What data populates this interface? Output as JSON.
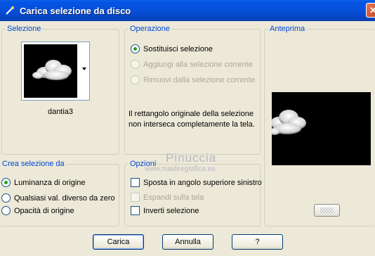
{
  "window": {
    "title": "Carica selezione da disco",
    "close_symbol": "✕"
  },
  "selezione": {
    "label": "Selezione",
    "selected_name": "dantia3"
  },
  "operazione": {
    "label": "Operazione",
    "options": [
      {
        "label": "Sostituisci selezione",
        "checked": true,
        "enabled": true
      },
      {
        "label": "Aggiungi alla selezione corrente",
        "checked": false,
        "enabled": false
      },
      {
        "label": "Rimuovi dalla selezione corrente",
        "checked": false,
        "enabled": false
      }
    ],
    "message_line1": "Il rettangolo originale della selezione",
    "message_line2": "non interseca completamente la tela."
  },
  "anteprima": {
    "label": "Anteprima"
  },
  "crea": {
    "label": "Crea selezione da",
    "options": [
      {
        "label": "Luminanza di origine",
        "checked": true
      },
      {
        "label": "Qualsiasi val. diverso da zero",
        "checked": false
      },
      {
        "label": "Opacità di origine",
        "checked": false
      }
    ]
  },
  "opzioni": {
    "label": "Opzioni",
    "items": [
      {
        "label": "Sposta in angolo superiore sinistro",
        "checked": false,
        "enabled": true
      },
      {
        "label": "Espandi sulla tela",
        "checked": false,
        "enabled": false
      },
      {
        "label": "Inverti selezione",
        "checked": false,
        "enabled": true
      }
    ]
  },
  "buttons": {
    "load": "Carica",
    "cancel": "Annulla",
    "help": "?"
  },
  "watermark": {
    "line1": "Pinuccia",
    "line2": "www.maidiregrafica.eu"
  },
  "colors": {
    "titlebar": "#0554e3",
    "group_label": "#0046d5",
    "dialog_bg": "#ece9d8"
  }
}
